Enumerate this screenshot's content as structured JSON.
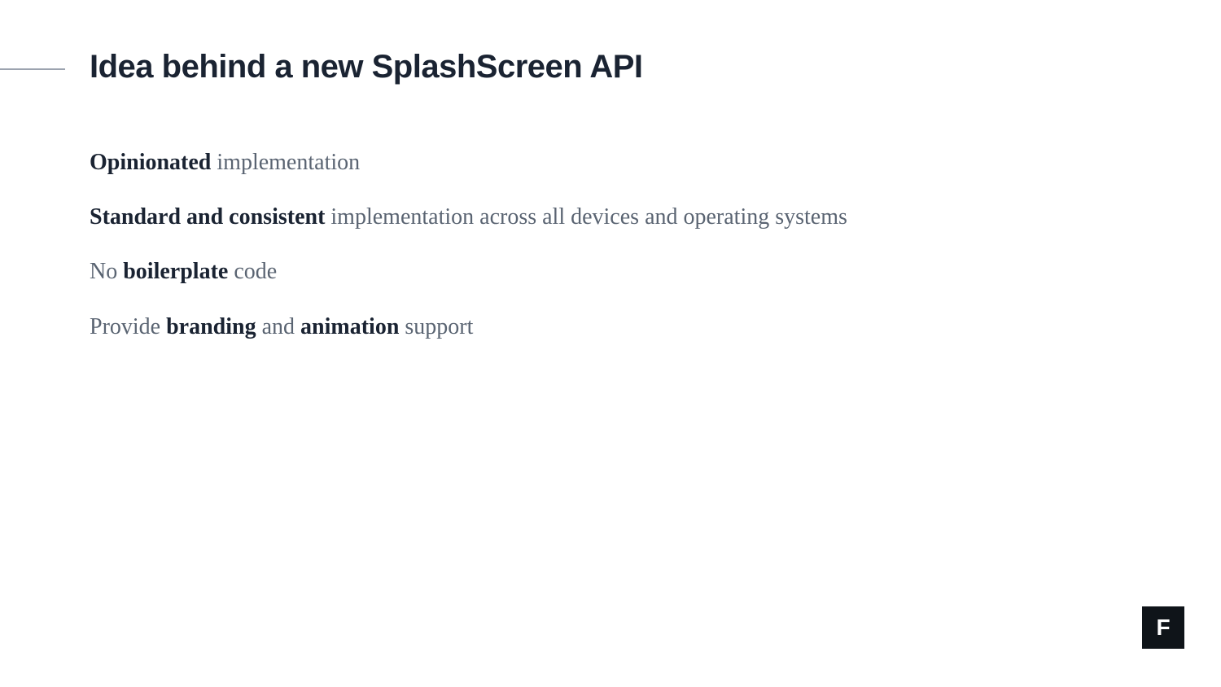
{
  "title": "Idea behind a new SplashScreen API",
  "bullets": [
    {
      "parts": [
        {
          "text": "Opinionated",
          "bold": true
        },
        {
          "text": " implementation",
          "bold": false
        }
      ]
    },
    {
      "parts": [
        {
          "text": "Standard and consistent",
          "bold": true
        },
        {
          "text": " implementation across all devices and operating systems",
          "bold": false
        }
      ]
    },
    {
      "parts": [
        {
          "text": "No ",
          "bold": false
        },
        {
          "text": "boilerplate",
          "bold": true
        },
        {
          "text": " code",
          "bold": false
        }
      ]
    },
    {
      "parts": [
        {
          "text": "Provide ",
          "bold": false
        },
        {
          "text": "branding",
          "bold": true
        },
        {
          "text": " and ",
          "bold": false
        },
        {
          "text": "animation",
          "bold": true
        },
        {
          "text": " support",
          "bold": false
        }
      ]
    }
  ],
  "logo": {
    "letter": "F"
  }
}
